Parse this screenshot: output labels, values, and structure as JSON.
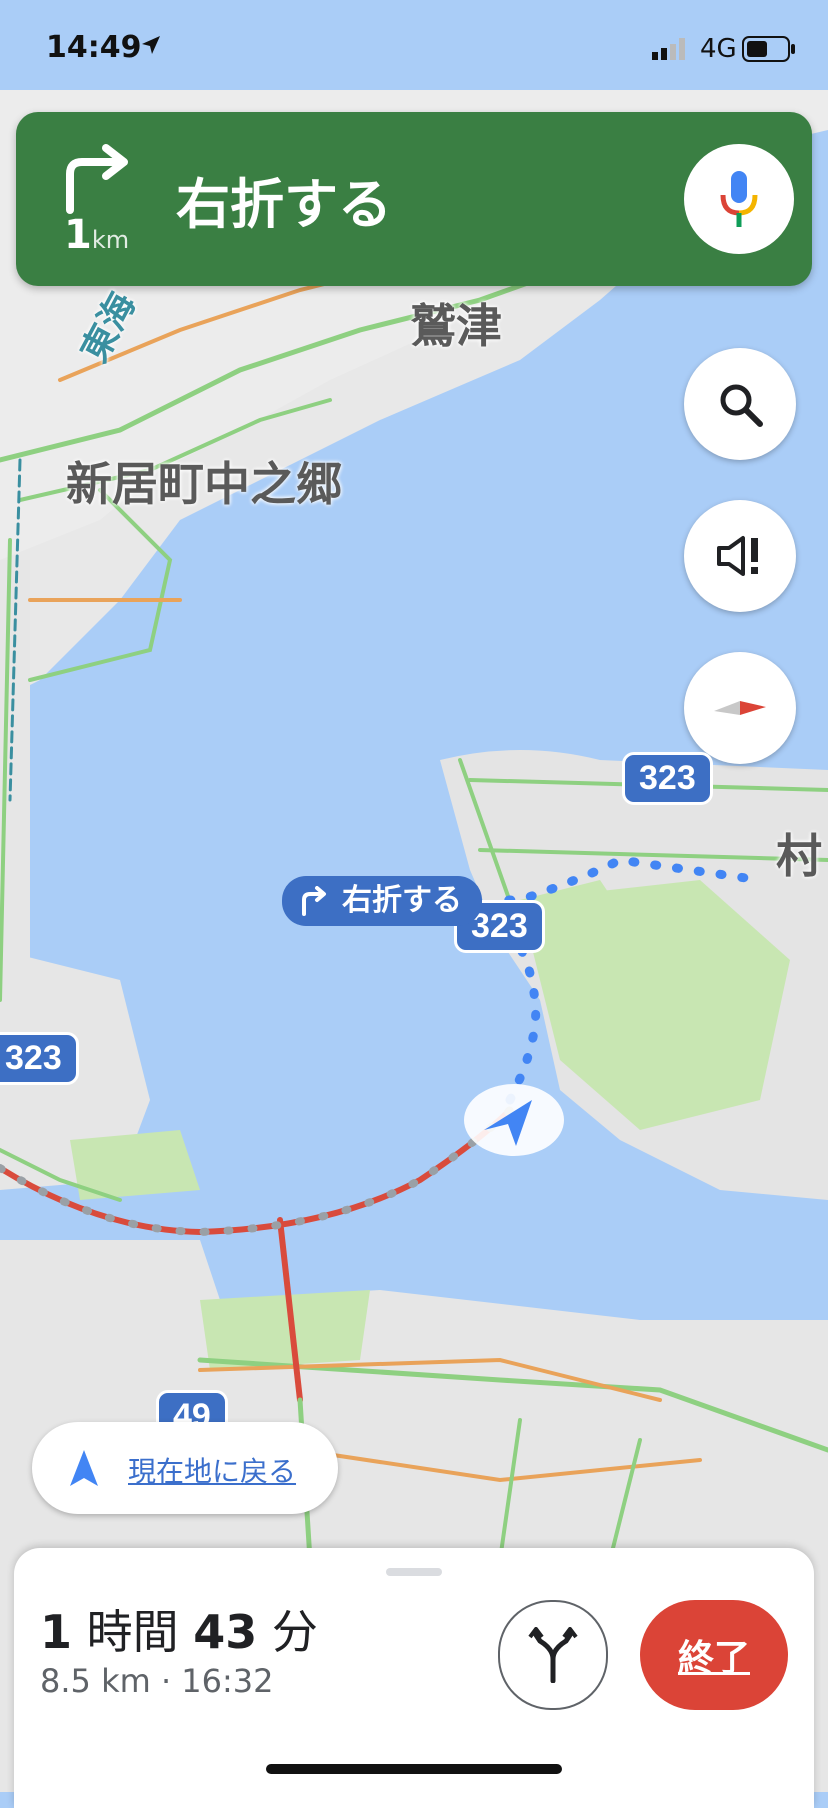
{
  "status_bar": {
    "time": "14:49",
    "network": "4G"
  },
  "navigation": {
    "distance_value": "1",
    "distance_unit": "km",
    "instruction": "右折する"
  },
  "map": {
    "place_labels": [
      "鷲津",
      "新居町中之郷",
      "村"
    ],
    "highway_label": "東海",
    "road_badges": [
      "323",
      "323",
      "323",
      "49"
    ],
    "turn_callout": "右折する"
  },
  "recenter": {
    "label": "現在地に戻る"
  },
  "trip": {
    "hours": "1",
    "hours_unit": "時間",
    "minutes": "43",
    "minutes_unit": "分",
    "summary": "8.5 km · 16:32",
    "end_label": "終了"
  },
  "colors": {
    "banner": "#3a7f43",
    "route_blue": "#4285f4",
    "end_red": "#db4437",
    "water": "#aacdf7",
    "land": "#e8e8e8",
    "park": "#c8e6b2"
  }
}
